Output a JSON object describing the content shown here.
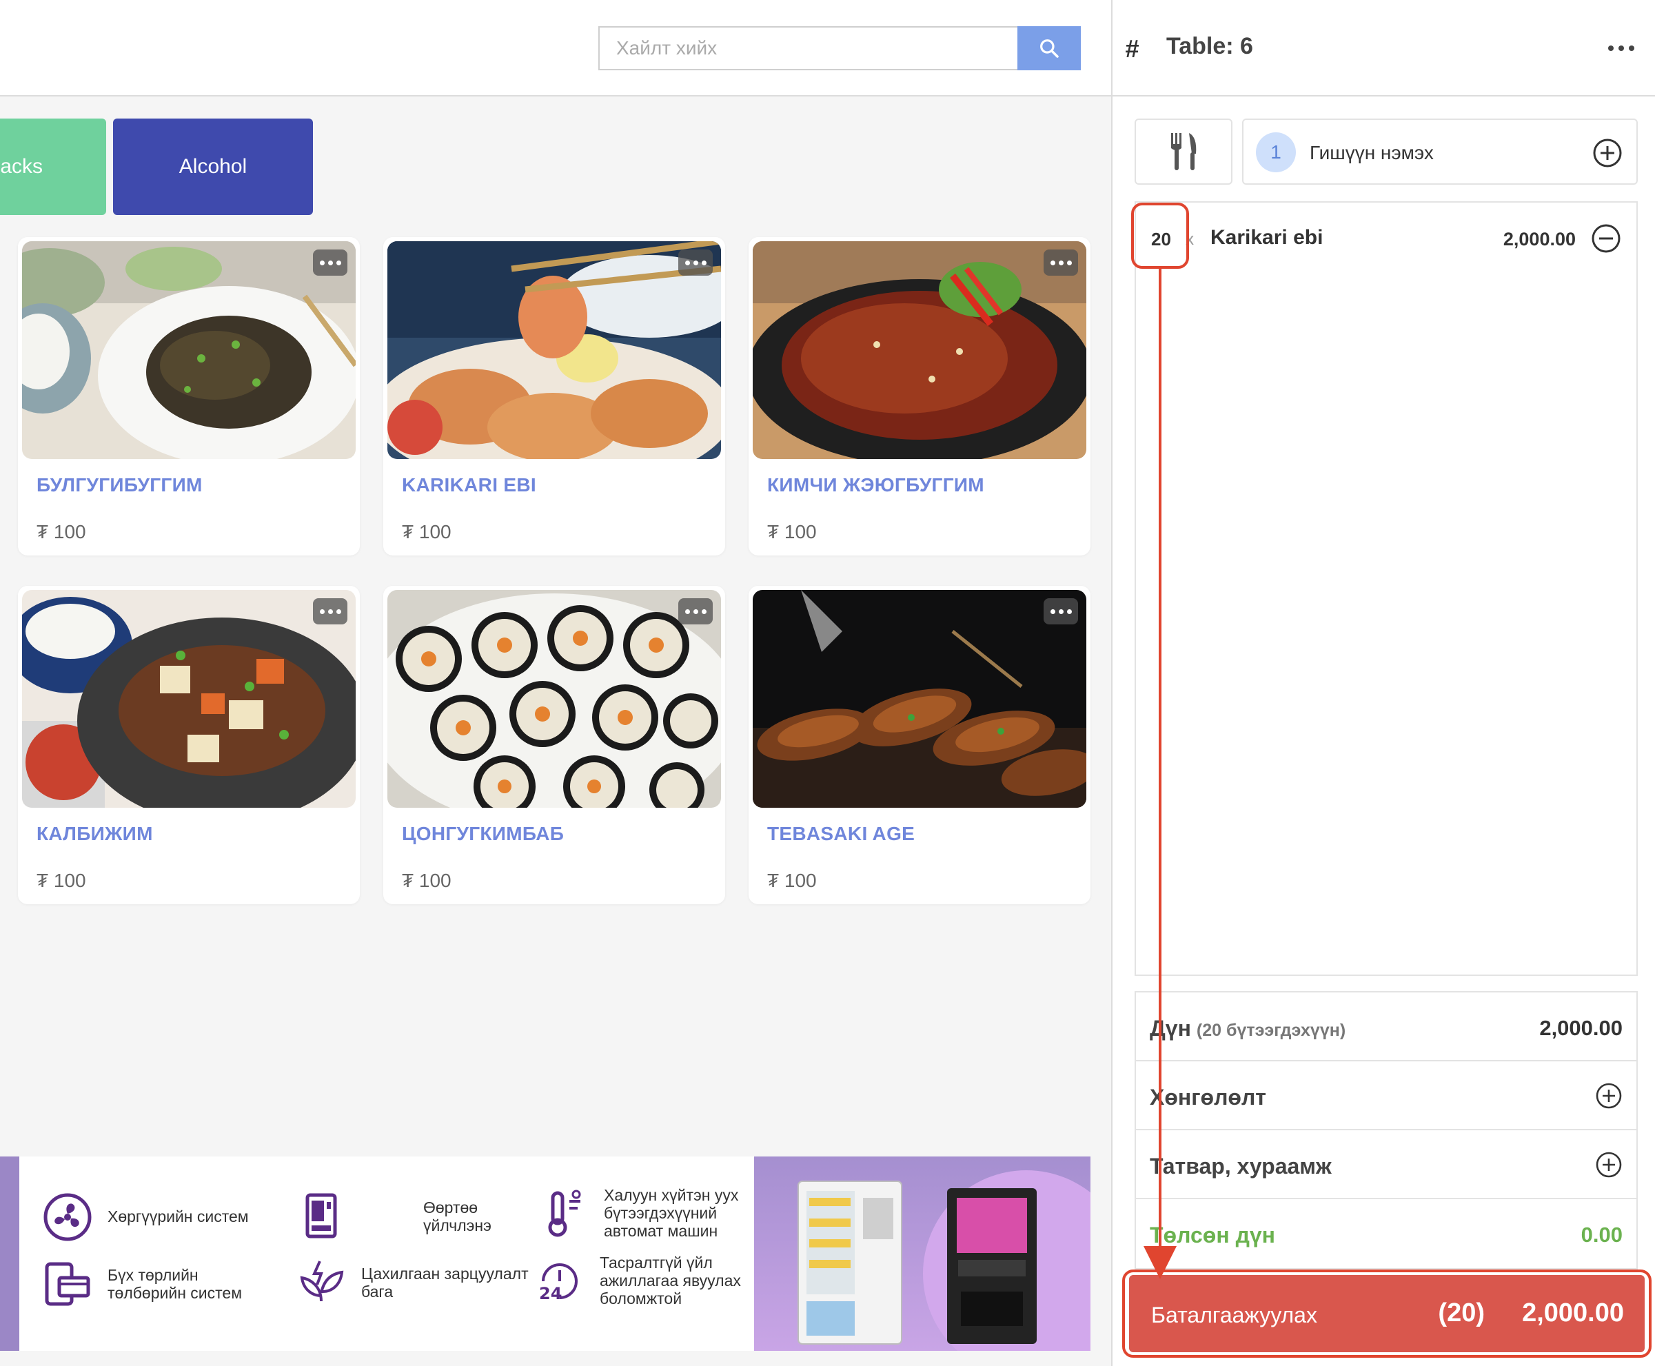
{
  "search": {
    "placeholder": "Хайлт хийх",
    "value": ""
  },
  "categories": [
    {
      "label": "acks",
      "color": "#6fd19d"
    },
    {
      "label": "Alcohol",
      "color": "#3f4aad"
    }
  ],
  "products": [
    {
      "name": "БУЛГУГИБУГГИМ",
      "price": "₮ 100"
    },
    {
      "name": "KARIKARI EBI",
      "price": "₮ 100"
    },
    {
      "name": "КИМЧИ ЖЭЮГБУГГИМ",
      "price": "₮ 100"
    },
    {
      "name": "КАЛБИЖИМ",
      "price": "₮ 100"
    },
    {
      "name": "ЦОНГУГКИМБАБ",
      "price": "₮ 100"
    },
    {
      "name": "TEBASAKI AGE",
      "price": "₮ 100"
    }
  ],
  "banner": {
    "features": [
      "Хөргүүрийн систем",
      "Өөртөө үйлчлэнэ",
      "Халуун хүйтэн уух бүтээгдэхүүний автомат машин",
      "Бүх төрлийн төлбөрийн систем",
      "Цахилгаан зарцуулалт бага",
      "Тасралтгүй үйл ажиллагаа явуулах боломжтой"
    ]
  },
  "order": {
    "table_label": "Table: 6",
    "member": {
      "count": "1",
      "label": "Гишүүн нэмэх"
    },
    "items": [
      {
        "qty": "20",
        "times": "x",
        "name": "Karikari ebi",
        "price": "2,000.00"
      }
    ],
    "summary": {
      "amount_label": "Дүн",
      "amount_sub": "(20 бүтээгдэхүүн)",
      "amount_value": "2,000.00",
      "discount_label": "Хөнгөлөлт",
      "tax_label": "Татвар, хураамж",
      "paid_label": "Төлсөн дүн",
      "paid_value": "0.00"
    },
    "confirm": {
      "label": "Баталгаажуулах",
      "count": "(20)",
      "total": "2,000.00"
    }
  },
  "colors": {
    "accent_blue": "#7b9fe8",
    "product_name": "#6f86db",
    "confirm": "#d9574d",
    "paid_green": "#6bb24f",
    "annotation_red": "#e0452f"
  }
}
